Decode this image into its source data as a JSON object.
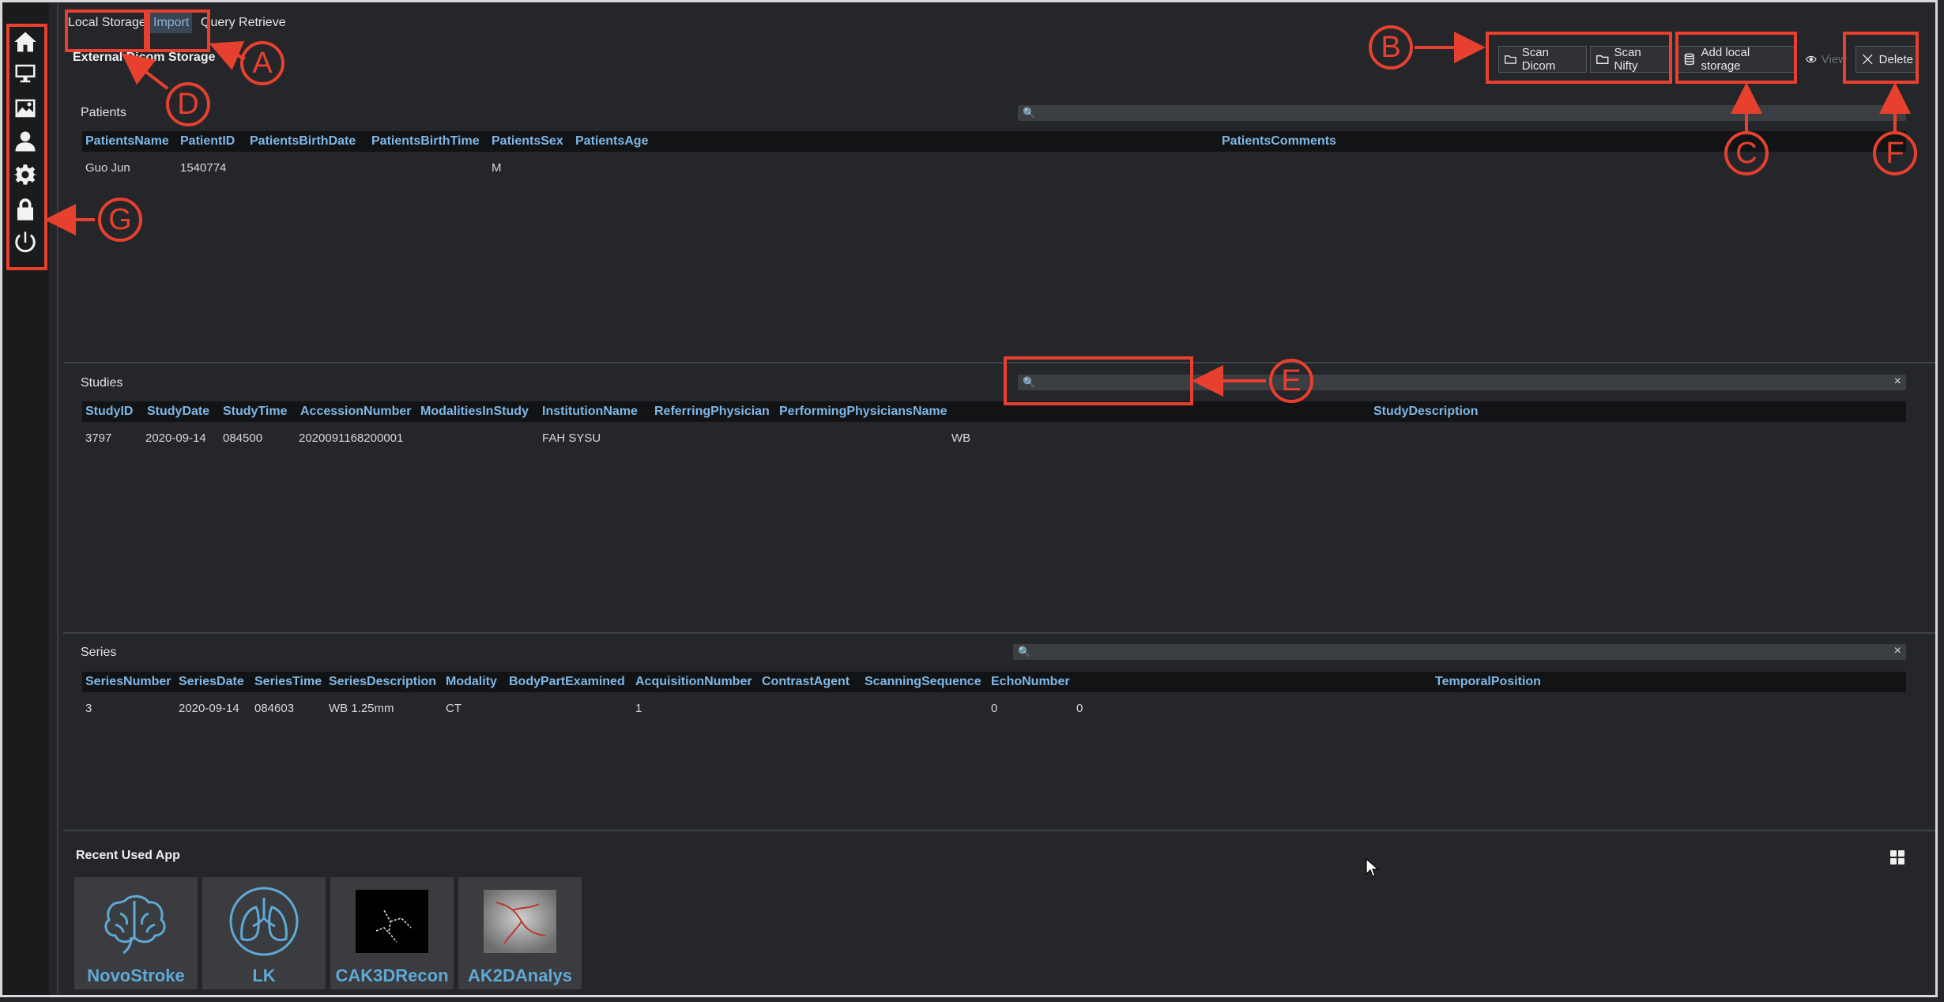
{
  "tabs": [
    {
      "label": "Local Storage"
    },
    {
      "label": "Import"
    },
    {
      "label": "Query Retrieve"
    }
  ],
  "storage_title": "External Dicom Storage",
  "toolbar": {
    "scan_dicom": "Scan Dicom",
    "scan_nifty": "Scan Nifty",
    "add_local_storage": "Add local storage",
    "view": "View",
    "delete": "Delete"
  },
  "sidebar": {
    "icons": [
      "home-icon",
      "monitor-icon",
      "image-icon",
      "user-icon",
      "gear-icon",
      "lock-icon",
      "power-icon"
    ]
  },
  "patients": {
    "title": "Patients",
    "columns": [
      "PatientsName",
      "PatientID",
      "PatientsBirthDate",
      "PatientsBirthTime",
      "PatientsSex",
      "PatientsAge",
      "PatientsComments"
    ],
    "rows": [
      [
        "Guo Jun",
        "1540774",
        "",
        "",
        "M",
        "",
        ""
      ]
    ]
  },
  "studies": {
    "title": "Studies",
    "columns": [
      "StudyID",
      "StudyDate",
      "StudyTime",
      "AccessionNumber",
      "ModalitiesInStudy",
      "InstitutionName",
      "ReferringPhysician",
      "PerformingPhysiciansName",
      "StudyDescription"
    ],
    "rows": [
      [
        "3797",
        "2020-09-14",
        "084500",
        "2020091168200001",
        "",
        "FAH SYSU",
        "",
        "WB",
        ""
      ]
    ]
  },
  "series": {
    "title": "Series",
    "columns": [
      "SeriesNumber",
      "SeriesDate",
      "SeriesTime",
      "SeriesDescription",
      "Modality",
      "BodyPartExamined",
      "AcquisitionNumber",
      "ContrastAgent",
      "ScanningSequence",
      "EchoNumber",
      "TemporalPosition"
    ],
    "rows": [
      [
        "3",
        "2020-09-14",
        "084603",
        "WB 1.25mm",
        "CT",
        "",
        "1",
        "",
        "",
        "0",
        "0"
      ]
    ]
  },
  "recent": {
    "title": "Recent Used App",
    "apps": [
      {
        "label": "NovoStroke",
        "icon": "brain-icon"
      },
      {
        "label": "LK",
        "icon": "lungs-icon"
      },
      {
        "label": "CAK3DRecon",
        "icon": "vessel-3d-thumbnail"
      },
      {
        "label": "AK2DAnalys",
        "icon": "angiogram-thumbnail"
      }
    ]
  },
  "annotations": [
    "A",
    "B",
    "C",
    "D",
    "E",
    "F",
    "G"
  ],
  "colors": {
    "background": "#24262a",
    "header_text": "#7fb7e6",
    "annotation": "#e8402e",
    "app_label": "#5fa9d6"
  }
}
